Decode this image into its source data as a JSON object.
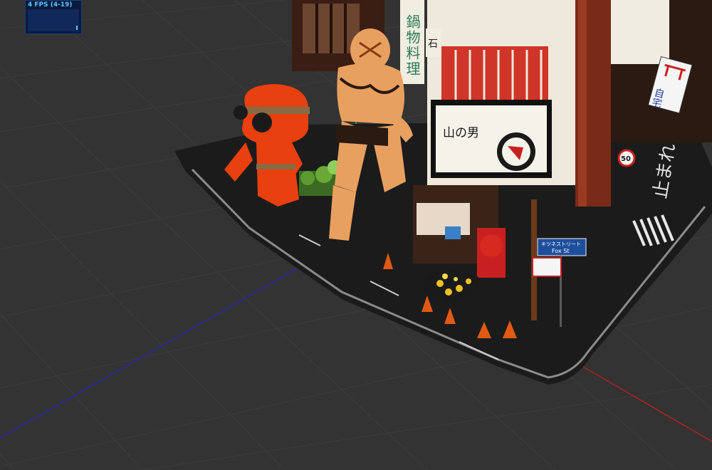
{
  "stats": {
    "fps_label": "4 FPS (4-19)",
    "fps_current": 4,
    "fps_min": 4,
    "fps_max": 19
  },
  "signs": {
    "restaurant_main": "山の男",
    "vertical_banner": "鍋物料理",
    "side_tag": "石",
    "shrine_sign": "自宅",
    "street_sign_top": "キツネストリート",
    "street_sign_bottom": "Fox St",
    "road_marking": "止まれ",
    "speed_limit": "50"
  },
  "scene": {
    "grid_color": "#3c3c3c",
    "background_color": "#333333",
    "axis_x_color": "#c81e1e",
    "axis_y_color": "#1ec81e",
    "axis_z_color": "#1e1ec8",
    "character_orange_color": "#e8400f",
    "character_muscle_color": "#e8a060"
  }
}
